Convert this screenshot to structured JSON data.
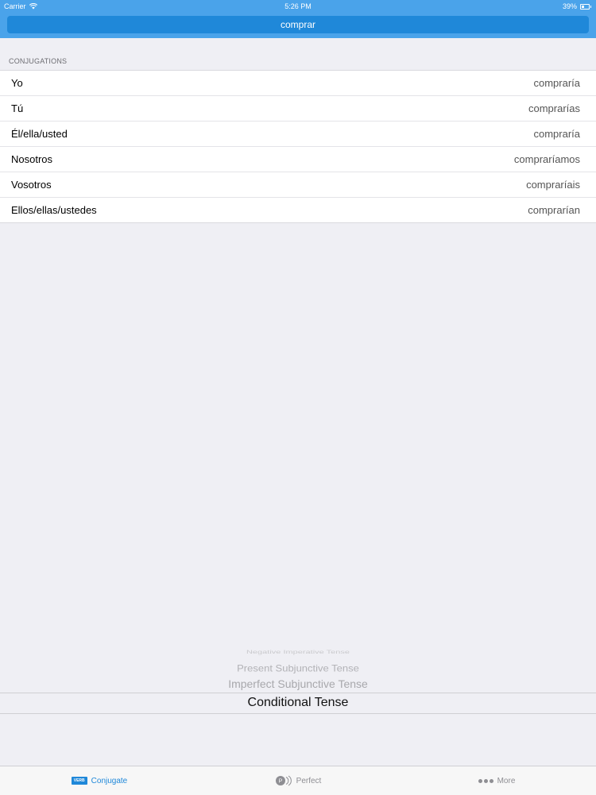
{
  "status_bar": {
    "carrier": "Carrier",
    "time": "5:26 PM",
    "battery": "39%",
    "battery_level": 0.39,
    "wifi_icon": "wifi-icon"
  },
  "verb_input": {
    "value": "comprar"
  },
  "conjugations": {
    "section_title": "CONJUGATIONS",
    "rows": [
      {
        "pronoun": "Yo",
        "form": "compraría"
      },
      {
        "pronoun": "Tú",
        "form": "comprarías"
      },
      {
        "pronoun": "Él/ella/usted",
        "form": "compraría"
      },
      {
        "pronoun": "Nosotros",
        "form": "compraríamos"
      },
      {
        "pronoun": "Vosotros",
        "form": "compraríais"
      },
      {
        "pronoun": "Ellos/ellas/ustedes",
        "form": "comprarían"
      }
    ]
  },
  "tense_picker": {
    "items": [
      "Negative Imperative Tense",
      "Present Subjunctive Tense",
      "Imperfect Subjunctive Tense"
    ],
    "selected": "Conditional Tense"
  },
  "tab_bar": {
    "tabs": [
      {
        "label": "Conjugate",
        "icon": "verb-icon",
        "icon_text": "VERB",
        "active": true
      },
      {
        "label": "Perfect",
        "icon": "perfect-icon",
        "active": false
      },
      {
        "label": "More",
        "icon": "more-dots-icon",
        "active": false
      }
    ]
  },
  "colors": {
    "header": "#4aa3ea",
    "input_field": "#1f88d9",
    "accent": "#1f88d9",
    "background": "#efeff4"
  }
}
